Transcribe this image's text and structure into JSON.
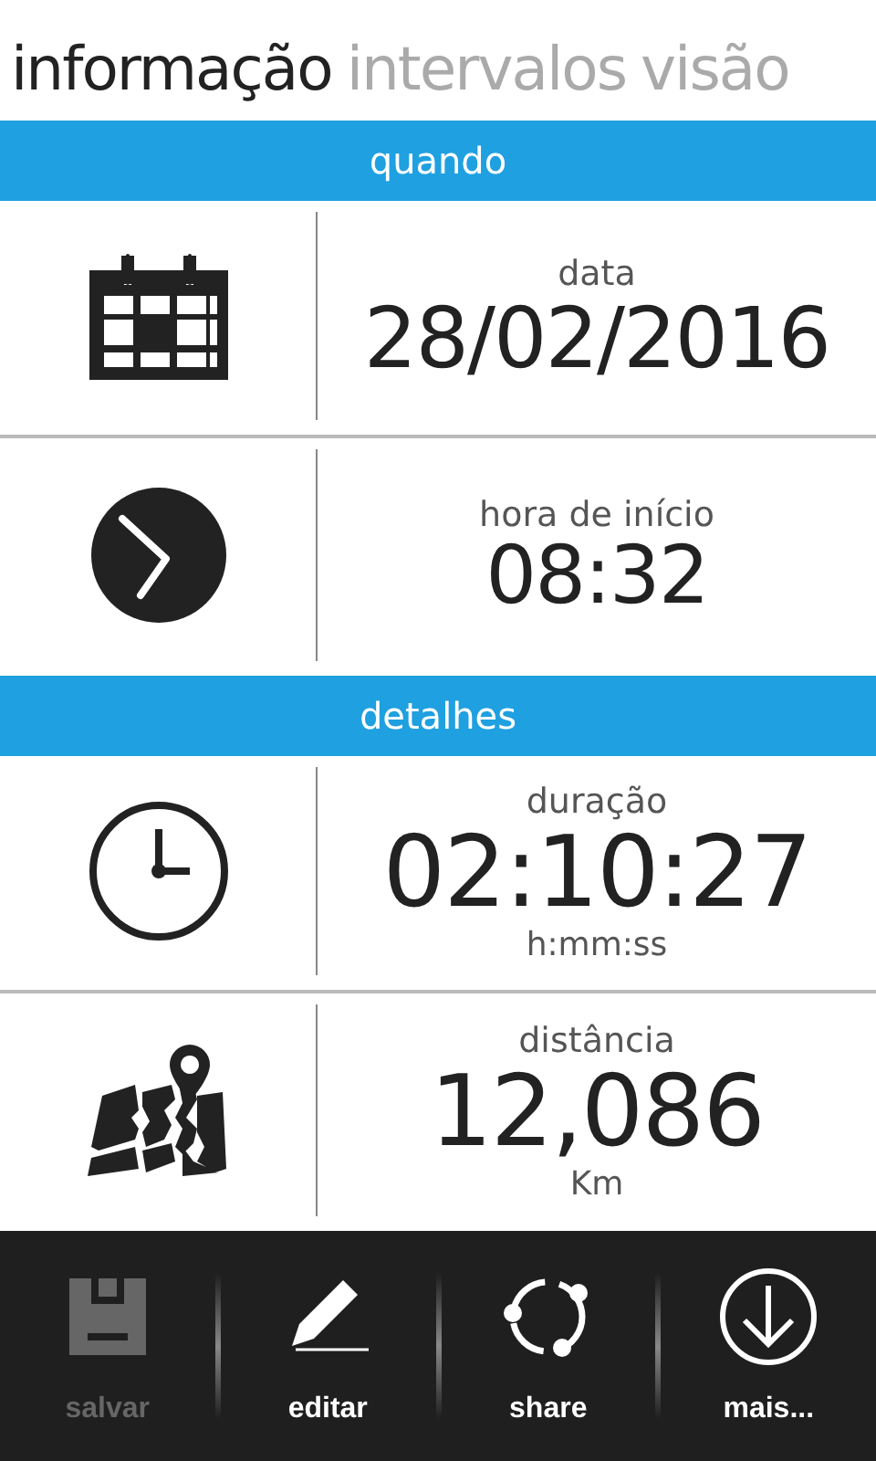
{
  "tabs": [
    {
      "label": "informação",
      "selected": true
    },
    {
      "label": "intervalos",
      "selected": false
    },
    {
      "label": "visão",
      "selected": false
    }
  ],
  "sections": [
    {
      "title": "quando",
      "rows": [
        {
          "label": "data",
          "value": "28/02/2016"
        },
        {
          "label": "hora de início",
          "value": "08:32"
        }
      ]
    },
    {
      "title": "detalhes",
      "rows": [
        {
          "label": "duração",
          "value": "02:10:27",
          "unit": "h:mm:ss"
        },
        {
          "label": "distância",
          "value": "12,086",
          "unit": "Km"
        }
      ]
    }
  ],
  "app_bar": [
    {
      "label": "salvar",
      "disabled": true
    },
    {
      "label": "editar",
      "disabled": false
    },
    {
      "label": "share",
      "disabled": false
    },
    {
      "label": "mais...",
      "disabled": false
    }
  ]
}
